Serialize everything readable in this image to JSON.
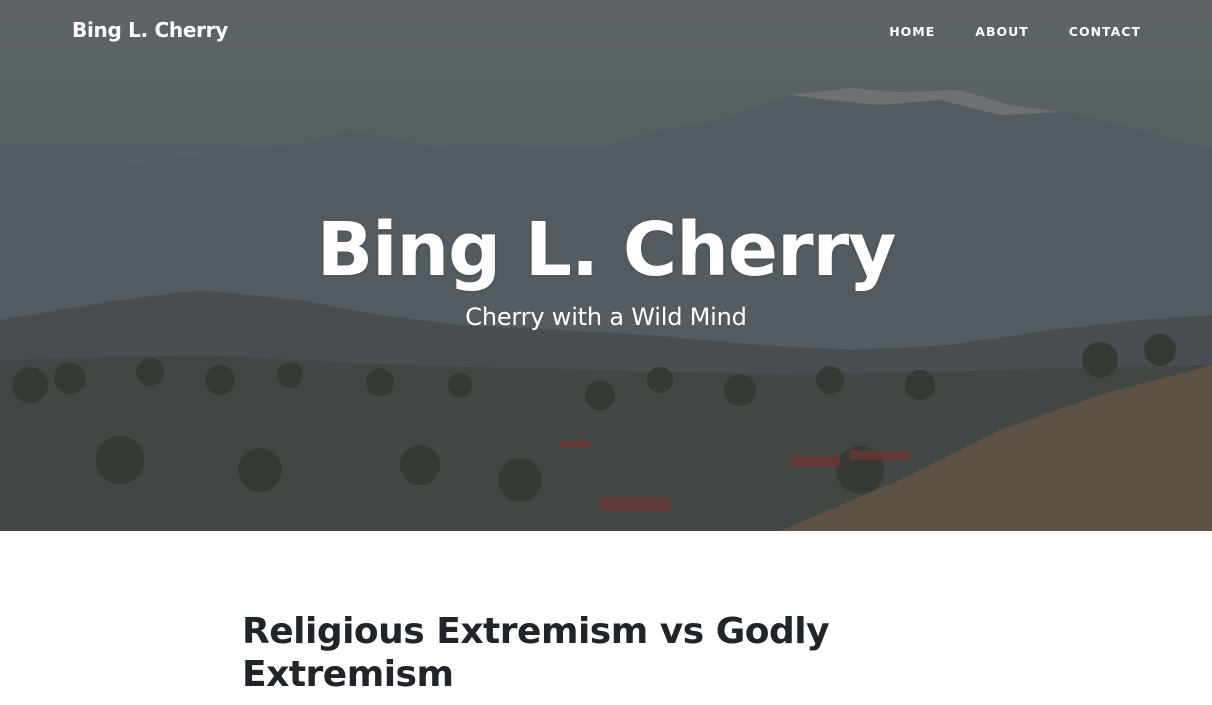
{
  "navbar": {
    "brand": "Bing L. Cherry",
    "links": [
      {
        "label": "HOME"
      },
      {
        "label": "ABOUT"
      },
      {
        "label": "CONTACT"
      }
    ]
  },
  "hero": {
    "title": "Bing L. Cherry",
    "subtitle": "Cherry with a Wild Mind"
  },
  "post": {
    "title": "Religious Extremism vs Godly Extremism"
  },
  "colors": {
    "hero_sky": "#6a706f",
    "hero_mountains": "#5c6469",
    "hero_foreground": "#463f36",
    "text_dark": "#212529",
    "text_light": "#ffffff"
  }
}
